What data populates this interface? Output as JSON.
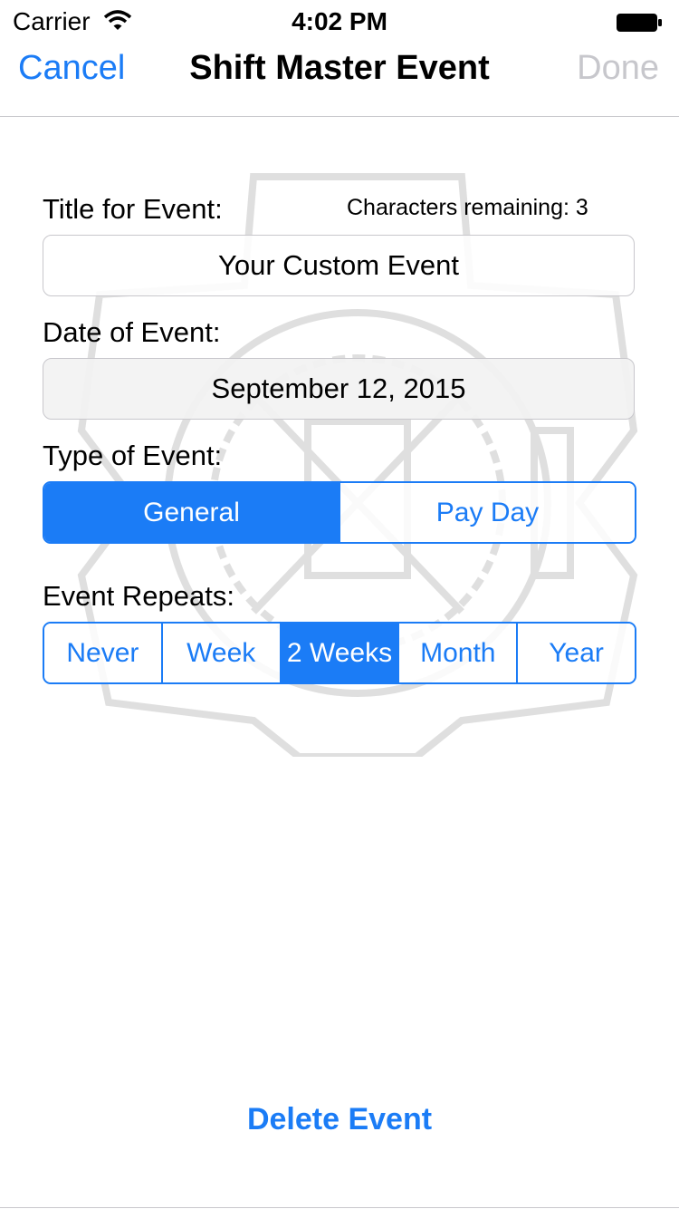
{
  "status_bar": {
    "carrier": "Carrier",
    "time": "4:02 PM"
  },
  "nav": {
    "cancel": "Cancel",
    "title": "Shift Master Event",
    "done": "Done"
  },
  "form": {
    "title_label": "Title for Event:",
    "chars_remaining": "Characters remaining: 3",
    "title_value": "Your Custom Event",
    "date_label": "Date of Event:",
    "date_value": "September 12, 2015",
    "type_label": "Type of Event:",
    "type_options": [
      "General",
      "Pay Day"
    ],
    "type_selected": "General",
    "repeat_label": "Event Repeats:",
    "repeat_options": [
      "Never",
      "Week",
      "2 Weeks",
      "Month",
      "Year"
    ],
    "repeat_selected": "2 Weeks"
  },
  "delete_label": "Delete Event",
  "colors": {
    "accent": "#1b7cf6",
    "disabled": "#c7c7cc",
    "border": "#c8c7cc"
  },
  "icons": [
    "wifi-icon",
    "battery-icon",
    "fire-department-emblem"
  ]
}
